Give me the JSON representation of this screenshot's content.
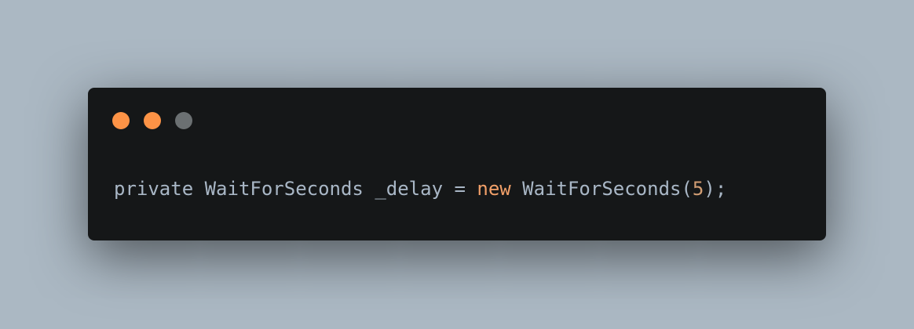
{
  "colors": {
    "background": "#abb8c3",
    "window": "#151718",
    "text": "#a9b7c6",
    "keyword": "#f2a069",
    "number": "#d29e74"
  },
  "window_controls": [
    {
      "name": "close-dot",
      "color": "#fd9346"
    },
    {
      "name": "minimize-dot",
      "color": "#fd9346"
    },
    {
      "name": "maximize-dot",
      "color": "#6b7072"
    }
  ],
  "code": {
    "tokens": [
      {
        "text": "private WaitForSeconds _delay = ",
        "type": "plain"
      },
      {
        "text": "new",
        "type": "keyword"
      },
      {
        "text": " WaitForSeconds(",
        "type": "plain"
      },
      {
        "text": "5",
        "type": "number"
      },
      {
        "text": ");",
        "type": "plain"
      }
    ]
  }
}
